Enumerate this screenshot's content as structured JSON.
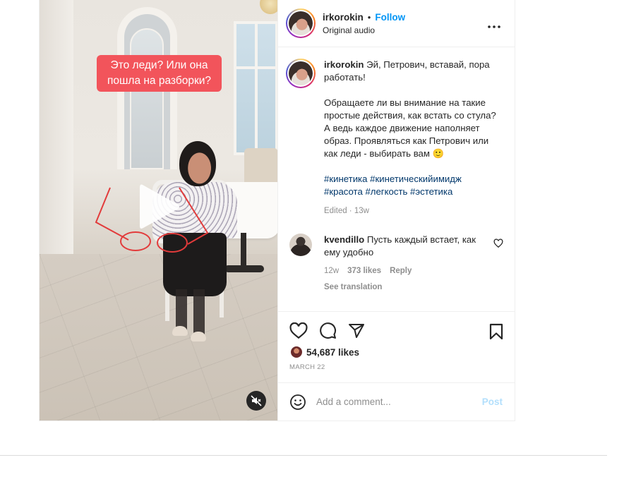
{
  "post": {
    "overlay_text": "Это леди? Или она пошла на разборки?",
    "header": {
      "username": "irkorokin",
      "separator": "•",
      "follow_label": "Follow",
      "audio_label": "Original audio",
      "more_icon": "more-horizontal-icon"
    },
    "caption": {
      "username": "irkorokin",
      "line1": "Эй, Петрович, вставай, пора работать!",
      "para2": "Обращаете ли вы внимание на такие простые действия, как встать со стула?",
      "para3": "А ведь каждое движение наполняет образ. Проявляться как Петрович или как леди - выбирать вам 🙂",
      "hashtags": "#кинетика #кинетическийимидж #красота #легкость #эстетика",
      "edited": "Edited · 13w"
    },
    "comment": {
      "username": "kvendillo",
      "text": "Пусть каждый встает, как ему удобно",
      "time": "12w",
      "likes": "373 likes",
      "reply_label": "Reply",
      "see_translation": "See translation"
    },
    "actions": {
      "likes_count": "54,687 likes",
      "date": "MARCH 22"
    },
    "add_comment": {
      "placeholder": "Add a comment...",
      "post_label": "Post"
    }
  },
  "colors": {
    "accent": "#0095f6",
    "overlay_bg": "#f2545b",
    "hashtag": "#00376b",
    "muted": "#8e8e8e",
    "post_disabled": "#b2dffc"
  }
}
